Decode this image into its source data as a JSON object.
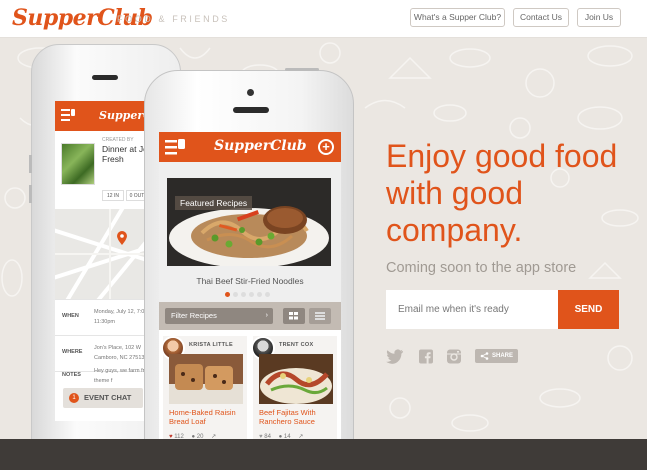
{
  "header": {
    "logo": "SupperClub",
    "tagline": "FOOD & FRIENDS",
    "nav": [
      {
        "label": "What's a Supper Club?"
      },
      {
        "label": "Contact Us"
      },
      {
        "label": "Join Us"
      }
    ]
  },
  "hero": {
    "headline": "Enjoy good food with good company.",
    "subhead": "Coming soon to the app store",
    "email_placeholder": "Email me when it's ready",
    "send_label": "SEND",
    "share_label": "SHARE"
  },
  "back_phone": {
    "logo": "SupperClub",
    "created_by": "CREATED BY",
    "event_title": "Dinner at Jo Farm Fresh",
    "date_boxes": [
      "12 IN",
      "0 OUT"
    ],
    "rows": [
      {
        "label": "WHEN",
        "value": "Monday, July 12, 7:00pm - 11:30pm"
      },
      {
        "label": "WHERE",
        "value": "Jon's Place, 102 W Camboro, NC 27513"
      },
      {
        "label": "NOTES",
        "value": "Hey guys, we farm fresh theme f"
      }
    ],
    "chat_label": "EVENT CHAT",
    "chat_count": "1"
  },
  "front_phone": {
    "logo": "SupperClub",
    "featured_label": "Featured Recipes",
    "featured_caption": "Thai Beef Stir-Fried Noodles",
    "filter_placeholder": "Filter Recipes",
    "cards": [
      {
        "author": "KRISTA LITTLE",
        "title": "Home-Baked Raisin Bread Loaf",
        "likes": "112",
        "comments": "20"
      },
      {
        "author": "TRENT COX",
        "title": "Beef Fajitas With Ranchero Sauce",
        "likes": "84",
        "comments": "14"
      }
    ]
  },
  "colors": {
    "brand": "#e0541b",
    "background": "#ebe7e2",
    "footer": "#3f3b38"
  },
  "icons": [
    "twitter-icon",
    "facebook-icon",
    "instagram-icon",
    "share-icon",
    "menu-icon",
    "plus-icon",
    "grid-view-icon",
    "list-view-icon",
    "heart-icon",
    "comment-icon",
    "map-pin-icon"
  ]
}
